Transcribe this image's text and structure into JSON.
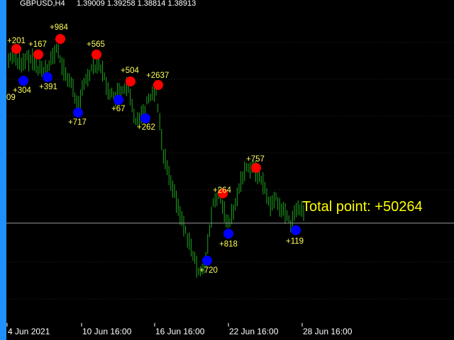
{
  "header": {
    "symbol_text": "GBPUSD,H4",
    "ohlc_text": "1.39009 1.39258 1.38814 1.38913",
    "price_edge_text": "09"
  },
  "colors": {
    "background": "#000000",
    "candle": "#1fa81f",
    "buy_dot": "#0000ff",
    "sell_dot": "#ff0000",
    "label": "#ffff55",
    "grid": "#2a2a2a",
    "left_edge": "#1e90ff"
  },
  "chart_data": {
    "type": "scatter",
    "title": "GBPUSD,H4",
    "x_axis_labels": [
      "4 Jun 2021",
      "10 Jun 16:00",
      "16 Jun 16:00",
      "22 Jun 16:00",
      "28 Jun 16:00"
    ],
    "series": [
      {
        "values": [
          {
            "label": "+201",
            "kind": "sell"
          },
          {
            "label": "+167",
            "kind": "sell"
          },
          {
            "label": "+984",
            "kind": "sell"
          },
          {
            "label": "+565",
            "kind": "sell"
          },
          {
            "label": "+504",
            "kind": "sell"
          },
          {
            "label": "+2637",
            "kind": "sell"
          },
          {
            "label": "+264",
            "kind": "sell"
          },
          {
            "label": "+757",
            "kind": "sell"
          }
        ]
      },
      {
        "values": [
          {
            "label": "+304",
            "kind": "buy"
          },
          {
            "label": "+391",
            "kind": "buy"
          },
          {
            "label": "+717",
            "kind": "buy"
          },
          {
            "label": "+67",
            "kind": "buy"
          },
          {
            "label": "+262",
            "kind": "buy"
          },
          {
            "label": "+720",
            "kind": "buy"
          },
          {
            "label": "+818",
            "kind": "buy"
          },
          {
            "label": "+119",
            "kind": "buy"
          }
        ]
      }
    ],
    "total_text": "Total point: +50264"
  }
}
